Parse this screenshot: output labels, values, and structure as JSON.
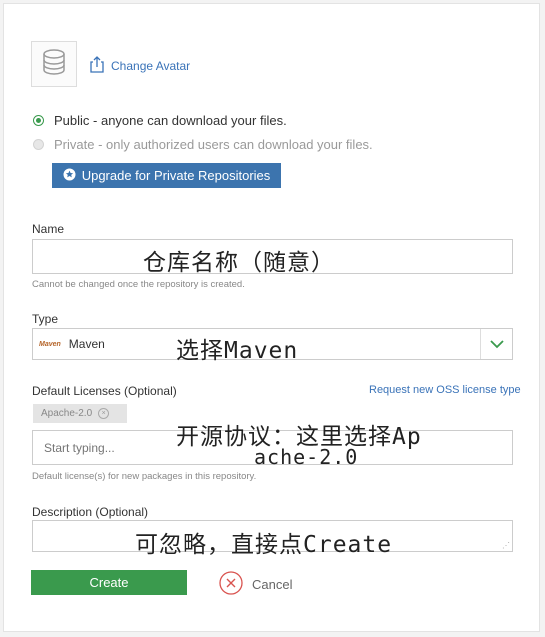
{
  "avatar": {
    "change_label": "Change Avatar"
  },
  "visibility": {
    "public_label": "Public - anyone can download your files.",
    "private_label": "Private - only authorized users can download your files.",
    "upgrade_label": "Upgrade for Private Repositories"
  },
  "name": {
    "label": "Name",
    "value": "",
    "help": "Cannot be changed once the repository is created.",
    "annotation": "仓库名称（随意）"
  },
  "type": {
    "label": "Type",
    "badge": "Maven",
    "value": "Maven",
    "annotation": "选择Maven"
  },
  "licenses": {
    "label": "Default Licenses (Optional)",
    "request_link": "Request new OSS license type",
    "tag": "Apache-2.0",
    "placeholder": "Start typing...",
    "help": "Default license(s) for new packages in this repository.",
    "annotation_line1": "开源协议：这里选择Ap",
    "annotation_line2": "ache-2.0"
  },
  "description": {
    "label": "Description (Optional)",
    "annotation": "可忽略，直接点Create"
  },
  "actions": {
    "create_label": "Create",
    "cancel_label": "Cancel"
  },
  "colors": {
    "accent_blue": "#3c74ae",
    "create_green": "#3a9a4d",
    "cancel_red": "#d9534f"
  }
}
